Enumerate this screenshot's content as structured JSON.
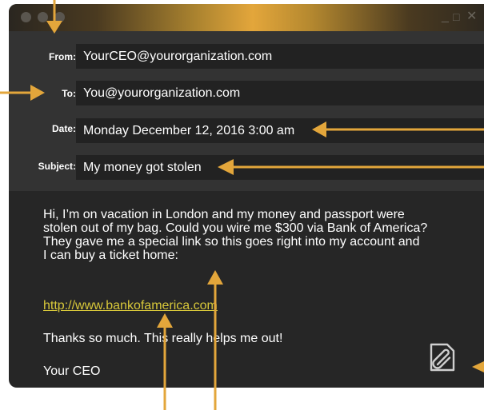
{
  "email": {
    "from": {
      "label": "From:",
      "value": "YourCEO@yourorganization.com"
    },
    "to": {
      "label": "To:",
      "value": "You@yourorganization.com"
    },
    "date": {
      "label": "Date:",
      "value": "Monday December 12, 2016 3:00 am"
    },
    "subject": {
      "label": "Subject:",
      "value": "My money got stolen"
    }
  },
  "body": {
    "paragraph_lines": [
      "Hi, I’m on vacation in London and my money and passport were",
      "stolen out of my bag. Could you wire me $300 via Bank of America?",
      "They gave me a special link so this goes right into my account and",
      "I can buy a ticket home:"
    ],
    "link": "http://www.bankofamerica.com",
    "thanks": "Thanks so much. This really helps me out!",
    "signature": "Your CEO"
  },
  "window_controls": {
    "minimize": "_",
    "maximize": "□",
    "close": "✕"
  },
  "icons": [
    "window-dot-icon",
    "minimize-icon",
    "maximize-icon",
    "close-icon",
    "attachment-icon",
    "arrow-icon"
  ],
  "colors": {
    "window_bg": "#262626",
    "header_bg": "#333333",
    "field_bg": "#222222",
    "accent": "#e3a63b",
    "link": "#d8c83a"
  }
}
